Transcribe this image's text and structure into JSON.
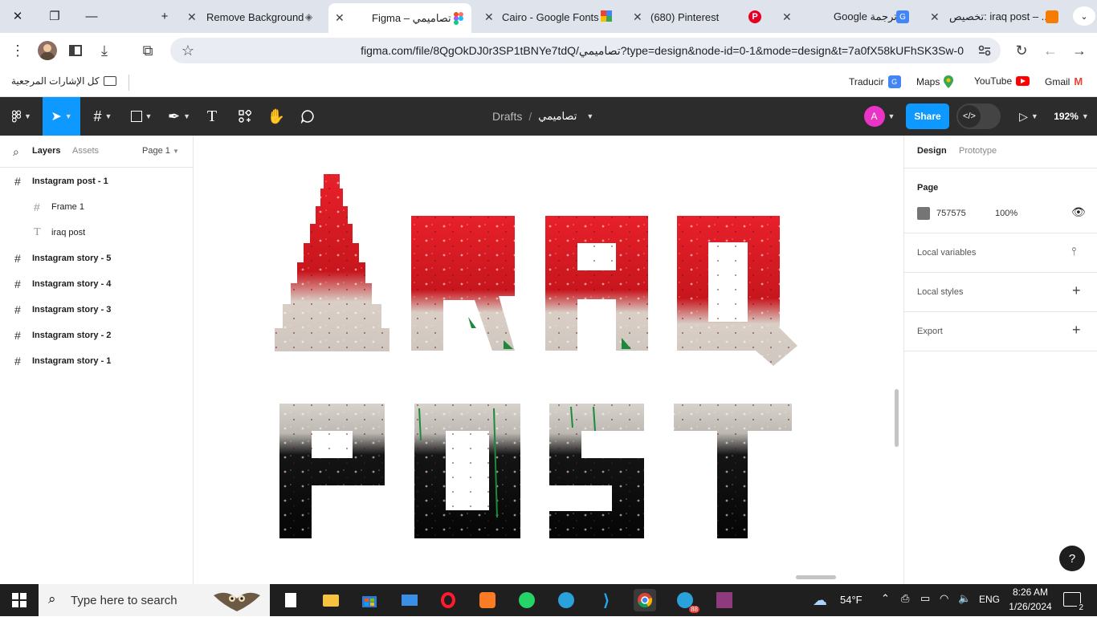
{
  "browser": {
    "tabs": [
      {
        "title": "Remove Background",
        "icon": "layers-icon"
      },
      {
        "title": "Figma – تصاميمي",
        "icon": "figma-icon",
        "active": true
      },
      {
        "title": "Cairo - Google Fonts",
        "icon": "google-fonts-icon"
      },
      {
        "title": "(680) Pinterest",
        "icon": "pinterest-icon"
      },
      {
        "title": "Google ترجمة",
        "icon": "translate-icon"
      },
      {
        "title": "تخصيص: iraq post – ...",
        "icon": "customize-icon"
      }
    ],
    "url": "figma.com/file/8QgOkDJ0r3SP1tBNYe7tdQ/تصاميمي?type=design&node-id=0-1&mode=design&t=7a0fX58kUFhSK3Sw-0",
    "bookmarks": {
      "all": "كل الإشارات المرجعية",
      "items": [
        "Traducir",
        "Maps",
        "YouTube",
        "Gmail"
      ]
    }
  },
  "figma": {
    "breadcrumb_team": "Drafts",
    "breadcrumb_sep": "/",
    "file_name": "تصاميمي",
    "avatar_letter": "A",
    "share_label": "Share",
    "zoom": "192%",
    "left_tabs": {
      "layers": "Layers",
      "assets": "Assets",
      "page": "Page 1"
    },
    "layers": [
      {
        "name": "Instagram post - 1",
        "type": "frame",
        "indent": 0
      },
      {
        "name": "Frame 1",
        "type": "frame",
        "indent": 1
      },
      {
        "name": "iraq post",
        "type": "text",
        "indent": 1
      },
      {
        "name": "Instagram story - 5",
        "type": "frame",
        "indent": 0
      },
      {
        "name": "Instagram story - 4",
        "type": "frame",
        "indent": 0
      },
      {
        "name": "Instagram story - 3",
        "type": "frame",
        "indent": 0
      },
      {
        "name": "Instagram story - 2",
        "type": "frame",
        "indent": 0
      },
      {
        "name": "Instagram story - 1",
        "type": "frame",
        "indent": 0
      }
    ],
    "right_tabs": {
      "design": "Design",
      "prototype": "Prototype"
    },
    "page": {
      "title": "Page",
      "color_hex": "757575",
      "color": "#757575",
      "opacity": "100%"
    },
    "sections": {
      "local_variables": "Local variables",
      "local_styles": "Local styles",
      "export": "Export"
    },
    "help": "?"
  },
  "taskbar": {
    "search_placeholder": "Type here to search",
    "weather": "54°F",
    "lang": "ENG",
    "time": "8:26 AM",
    "date": "1/26/2024",
    "notifications": "2",
    "telegram_badge": "88"
  }
}
